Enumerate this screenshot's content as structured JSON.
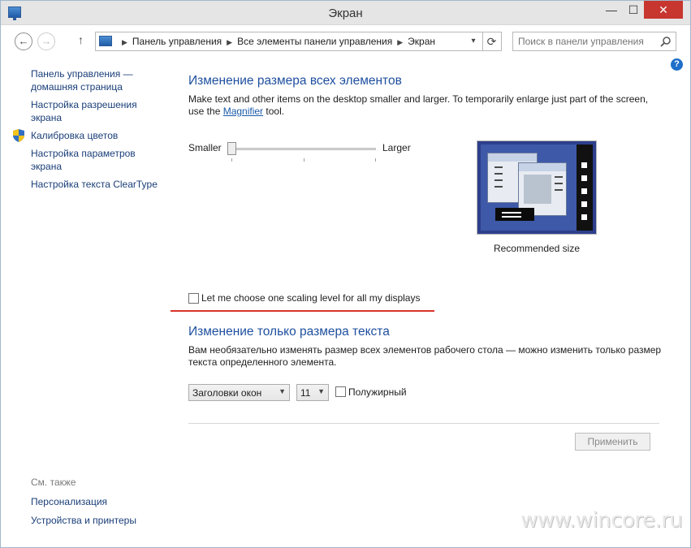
{
  "window": {
    "title": "Экран"
  },
  "titlebar": {
    "minimize": "—",
    "maximize": "☐",
    "close": "✕"
  },
  "nav": {
    "back": "←",
    "forward": "→",
    "up": "↑"
  },
  "address": {
    "crumbs": [
      "Панель управления",
      "Все элементы панели управления",
      "Экран"
    ],
    "dropdown": "▾",
    "refresh": "⟳"
  },
  "search": {
    "placeholder": "Поиск в панели управления"
  },
  "help": "?",
  "sidebar": {
    "items": [
      {
        "label": "Панель управления —\nдомашняя страница"
      },
      {
        "label": "Настройка разрешения\nэкрана"
      },
      {
        "label": "Калибровка цветов",
        "icon": "shield-icon"
      },
      {
        "label": "Настройка параметров\nэкрана"
      },
      {
        "label": "Настройка текста ClearType"
      }
    ],
    "see_also_title": "См. также",
    "see_also": [
      {
        "label": "Персонализация"
      },
      {
        "label": "Устройства и принтеры"
      }
    ]
  },
  "scaling": {
    "heading": "Изменение размера всех элементов",
    "desc_before": "Make text and other items on the desktop smaller and larger. To temporarily enlarge just part of the screen, use the ",
    "desc_link": "Magnifier",
    "desc_after": " tool.",
    "smaller": "Smaller",
    "larger": "Larger",
    "slider_level": 0,
    "preview_caption": "Recommended size",
    "one_level_label": "Let me choose one scaling level for all my displays",
    "one_level_checked": false
  },
  "text_only": {
    "heading": "Изменение только размера текста",
    "desc": "Вам необязательно изменять размер всех элементов рабочего стола — можно изменить только размер текста определенного элемента.",
    "element_select": "Заголовки окон",
    "size_select": "11",
    "bold_label": "Полужирный",
    "bold_checked": false
  },
  "apply_button": "Применить",
  "watermark": "www.wincore.ru",
  "colors": {
    "heading": "#1e4f9e",
    "link": "#1a3e78",
    "close": "#c7372f",
    "red_rule": "#d9322b"
  }
}
